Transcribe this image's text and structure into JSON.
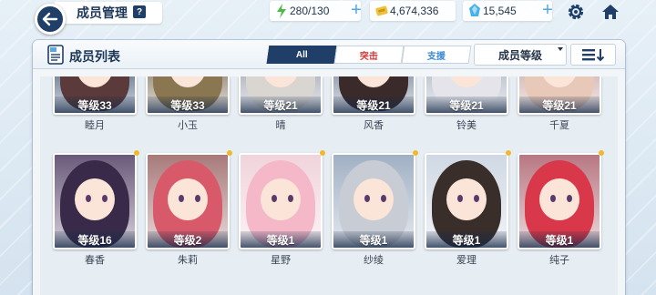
{
  "header": {
    "title": "成员管理",
    "help_label": "?",
    "ap": "280/130",
    "gold": "4,674,336",
    "gems": "15,545",
    "plus": "+"
  },
  "panel": {
    "title": "成员列表",
    "tabs": {
      "all": "All",
      "strike": "突击",
      "support": "支援"
    },
    "sort_label": "成员等级"
  },
  "members_row1": [
    {
      "level": "等级33",
      "name": "睦月",
      "hair": "#5a3a3a",
      "bg": "#7a8aa0"
    },
    {
      "level": "等级33",
      "name": "小玉",
      "hair": "#8a7650",
      "bg": "#a49a8a"
    },
    {
      "level": "等级21",
      "name": "晴",
      "hair": "#d9d6d2",
      "bg": "#b8bcc4"
    },
    {
      "level": "等级21",
      "name": "风香",
      "hair": "#3a2a2a",
      "bg": "#9aa4b4"
    },
    {
      "level": "等级21",
      "name": "铃美",
      "hair": "#e4e4ea",
      "bg": "#c4c8d4"
    },
    {
      "level": "等级21",
      "name": "千夏",
      "hair": "#e8c8b8",
      "bg": "#d8c0bc"
    }
  ],
  "members_row2": [
    {
      "level": "等级16",
      "name": "春香",
      "hair": "#3a2a4a",
      "bg": "#6a5a7a"
    },
    {
      "level": "等级2",
      "name": "朱莉",
      "hair": "#d85a6a",
      "bg": "#a87a7a"
    },
    {
      "level": "等级1",
      "name": "星野",
      "hair": "#f4b8c8",
      "bg": "#f0d4dc"
    },
    {
      "level": "等级1",
      "name": "纱绫",
      "hair": "#c8ccd4",
      "bg": "#a0b0c4"
    },
    {
      "level": "等级1",
      "name": "爱理",
      "hair": "#3a2e2a",
      "bg": "#cfd8e4"
    },
    {
      "level": "等级1",
      "name": "纯子",
      "hair": "#d8384a",
      "bg": "#b87882"
    }
  ],
  "colors": {
    "accent": "#1f3f68",
    "level_dot": "#f3b82a",
    "strike": "#d23a3a",
    "support": "#3a8ad2"
  }
}
